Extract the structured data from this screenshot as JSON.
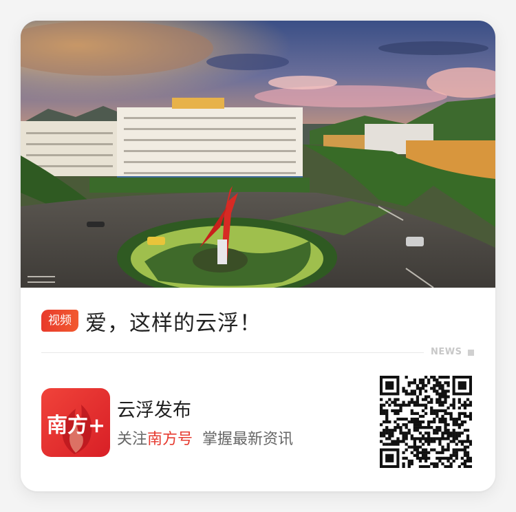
{
  "headline": {
    "badge": "视频",
    "title": "爱，这样的云浮！"
  },
  "news_label": "NEWS",
  "account": {
    "name": "云浮发布",
    "follow_prefix": "关注",
    "platform": "南方号",
    "slogan": "掌握最新资讯",
    "logo_text": "南方+"
  },
  "colors": {
    "accent_red": "#e63a2f",
    "badge_gradient_start": "#e83a2c",
    "badge_gradient_end": "#f25a2f"
  },
  "icons": {
    "hero": "city-roundabout-photo",
    "logo": "nanfang-plus-logo-icon",
    "qr": "qr-code-icon"
  }
}
